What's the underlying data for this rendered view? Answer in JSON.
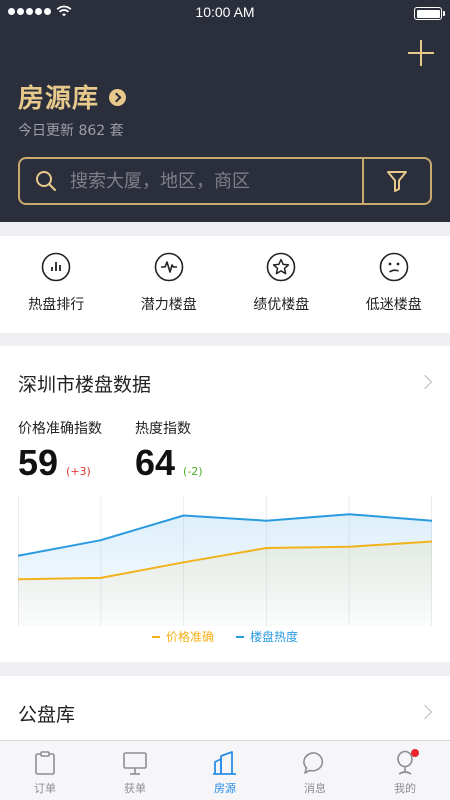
{
  "status_bar": {
    "time": "10:00 AM"
  },
  "header": {
    "title": "房源库",
    "subtitle": "今日更新 862 套",
    "search_placeholder": "搜索大厦，地区，商区"
  },
  "quick_actions": [
    {
      "label": "热盘排行",
      "icon": "bar-chart-icon"
    },
    {
      "label": "潜力楼盘",
      "icon": "pulse-icon"
    },
    {
      "label": "绩优楼盘",
      "icon": "star-icon"
    },
    {
      "label": "低迷楼盘",
      "icon": "sad-face-icon"
    }
  ],
  "data_card": {
    "title": "深圳市楼盘数据",
    "metrics": [
      {
        "label": "价格准确指数",
        "value": "59",
        "change": "(+3)",
        "change_color": "#e0352f"
      },
      {
        "label": "热度指数",
        "value": "64",
        "change": "(-2)",
        "change_color": "#4caf27"
      }
    ]
  },
  "chart_data": {
    "type": "area",
    "x_count": 6,
    "ylim": [
      0,
      100
    ],
    "grid": "vertical",
    "series": [
      {
        "name": "价格准确",
        "color": "#f2b21b",
        "values": [
          36,
          37,
          49,
          60,
          61,
          65
        ]
      },
      {
        "name": "楼盘热度",
        "color": "#2a9ae0",
        "values": [
          54,
          66,
          85,
          81,
          86,
          81
        ]
      }
    ]
  },
  "public_section": {
    "title": "公盘库"
  },
  "tab_bar": {
    "items": [
      {
        "label": "订单",
        "icon": "clipboard-icon",
        "active": false
      },
      {
        "label": "获单",
        "icon": "monitor-icon",
        "active": false
      },
      {
        "label": "房源",
        "icon": "building-icon",
        "active": true
      },
      {
        "label": "消息",
        "icon": "chat-icon",
        "active": false
      },
      {
        "label": "我的",
        "icon": "person-icon",
        "active": false,
        "badge": true
      }
    ]
  }
}
